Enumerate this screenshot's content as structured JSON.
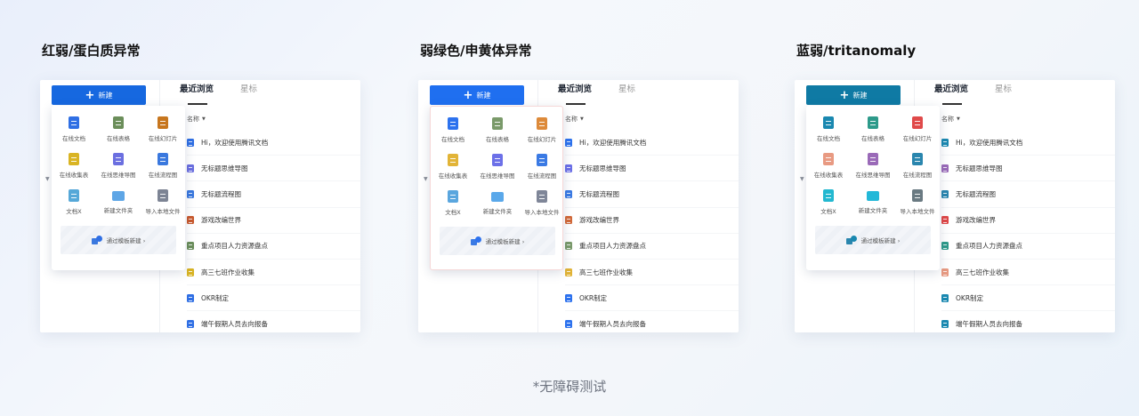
{
  "panels": [
    {
      "title": "红弱/蛋白质异常",
      "colors": {
        "accent": "#1668e0",
        "doc": "#2f6fe4",
        "sheet": "#6b8e5a",
        "slide": "#c7761e",
        "collect": "#d9b423",
        "mind": "#6b6fe0",
        "flow": "#3a78de",
        "docx": "#56a8d8",
        "folder": "#5ea6e6",
        "import": "#7d8494",
        "pdf": "#c95a2e",
        "dropdownBorder": "#ffffff"
      }
    },
    {
      "title": "弱绿色/申黄体异常",
      "colors": {
        "accent": "#1f6ff0",
        "doc": "#2d72ee",
        "sheet": "#7a9a6a",
        "slide": "#dd8a3a",
        "collect": "#e2b437",
        "mind": "#6c70e8",
        "flow": "#3a7ae4",
        "docx": "#5aa6de",
        "folder": "#5aa8ea",
        "import": "#7f8698",
        "pdf": "#d36a3a",
        "dropdownBorder": "#f6d8d8"
      }
    },
    {
      "title": "蓝弱/tritanomaly",
      "colors": {
        "accent": "#0f7aa4",
        "doc": "#1a88b0",
        "sheet": "#2d9a8a",
        "slide": "#e04a4a",
        "collect": "#e89a82",
        "mind": "#9a6ab8",
        "flow": "#2a86ae",
        "docx": "#23b8d0",
        "folder": "#23b8d8",
        "import": "#6a7a82",
        "pdf": "#e04848",
        "dropdownBorder": "#ffffff"
      }
    }
  ],
  "ui": {
    "new_button": "新建",
    "tabs": [
      "最近浏览",
      "星标"
    ],
    "column_header": "名称",
    "create_items": [
      {
        "label": "在线文档",
        "icon": "doc"
      },
      {
        "label": "在线表格",
        "icon": "sheet"
      },
      {
        "label": "在线幻灯片",
        "icon": "slide"
      },
      {
        "label": "在线收集表",
        "icon": "collect"
      },
      {
        "label": "在线思维导图",
        "icon": "mind"
      },
      {
        "label": "在线流程图",
        "icon": "flow"
      },
      {
        "label": "文档X",
        "icon": "docx"
      },
      {
        "label": "新建文件夹",
        "icon": "folder"
      },
      {
        "label": "导入本地文件",
        "icon": "import"
      }
    ],
    "template_label": "通过模板新建 ›",
    "files": [
      {
        "name": "Hi，欢迎使用腾讯文档",
        "icon": "doc"
      },
      {
        "name": "无标题思维导图",
        "icon": "mind"
      },
      {
        "name": "无标题流程图",
        "icon": "flow"
      },
      {
        "name": "游戏改编世界",
        "icon": "pdf"
      },
      {
        "name": "重点项目人力资源盘点",
        "icon": "sheet"
      },
      {
        "name": "高三七班作业收集",
        "icon": "collect"
      },
      {
        "name": "OKR制定",
        "icon": "doc"
      },
      {
        "name": "端午假期人员去向报备",
        "icon": "doc"
      }
    ]
  },
  "footer_note": "*无障碍测试"
}
